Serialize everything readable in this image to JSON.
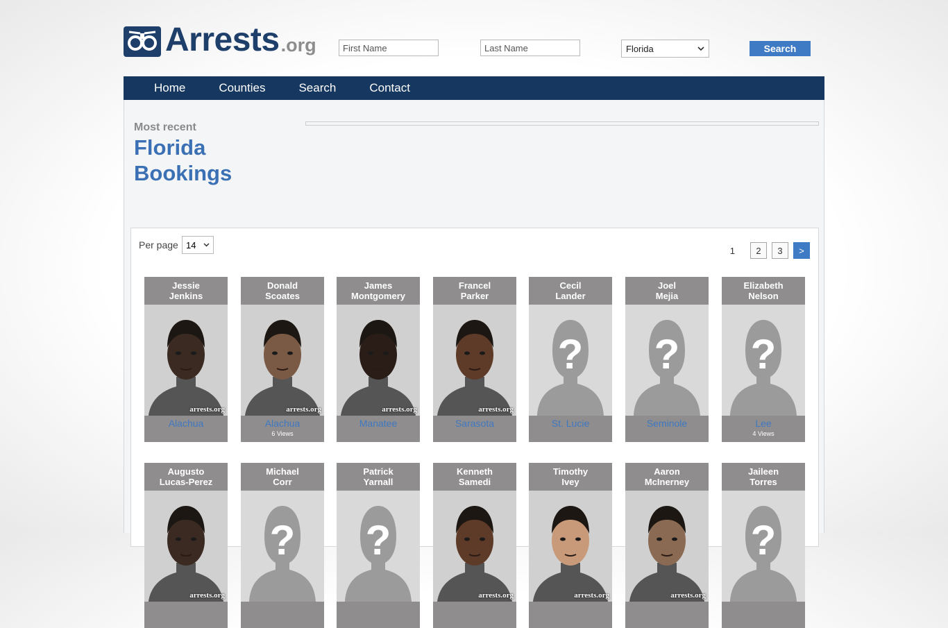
{
  "header": {
    "logo_main": "Arrests",
    "logo_tld": ".org",
    "first_name_placeholder": "First Name",
    "last_name_placeholder": "Last Name",
    "state_selected": "Florida",
    "search_label": "Search"
  },
  "nav": [
    "Home",
    "Counties",
    "Search",
    "Contact"
  ],
  "intro": {
    "most_recent": "Most recent",
    "state": "Florida",
    "bookings": "Bookings"
  },
  "results": {
    "per_page_label": "Per page",
    "per_page_value": "14",
    "pagination": {
      "current": "1",
      "pages": [
        "2",
        "3"
      ],
      "next": ">"
    }
  },
  "bookings": [
    {
      "first": "Jessie",
      "last": "Jenkins",
      "county": "Alachua",
      "views": "",
      "photo": "mugshot"
    },
    {
      "first": "Donald",
      "last": "Scoates",
      "county": "Alachua",
      "views": "6 Views",
      "photo": "mugshot"
    },
    {
      "first": "James",
      "last": "Montgomery",
      "county": "Manatee",
      "views": "",
      "photo": "mugshot"
    },
    {
      "first": "Francel",
      "last": "Parker",
      "county": "Sarasota",
      "views": "",
      "photo": "mugshot"
    },
    {
      "first": "Cecil",
      "last": "Lander",
      "county": "St. Lucie",
      "views": "",
      "photo": "placeholder"
    },
    {
      "first": "Joel",
      "last": "Mejia",
      "county": "Seminole",
      "views": "",
      "photo": "placeholder"
    },
    {
      "first": "Elizabeth",
      "last": "Nelson",
      "county": "Lee",
      "views": "4 Views",
      "photo": "placeholder"
    },
    {
      "first": "Augusto",
      "last": "Lucas-Perez",
      "county": "",
      "views": "",
      "photo": "mugshot"
    },
    {
      "first": "Michael",
      "last": "Corr",
      "county": "",
      "views": "",
      "photo": "placeholder"
    },
    {
      "first": "Patrick",
      "last": "Yarnall",
      "county": "",
      "views": "",
      "photo": "placeholder"
    },
    {
      "first": "Kenneth",
      "last": "Samedi",
      "county": "",
      "views": "",
      "photo": "mugshot"
    },
    {
      "first": "Timothy",
      "last": "Ivey",
      "county": "",
      "views": "",
      "photo": "mugshot"
    },
    {
      "first": "Aaron",
      "last": "McInerney",
      "county": "",
      "views": "",
      "photo": "mugshot"
    },
    {
      "first": "Jaileen",
      "last": "Torres",
      "county": "",
      "views": "",
      "photo": "placeholder"
    }
  ],
  "watermark": "arrests.org",
  "colors": {
    "brand": "#1f3f6b",
    "nav": "#163860",
    "accent": "#3f7bc4",
    "card": "#8f8d8d"
  }
}
